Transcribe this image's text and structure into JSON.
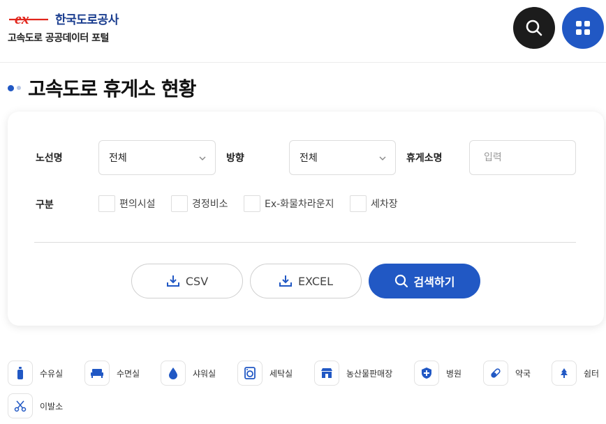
{
  "header": {
    "logo_brand": "한국도로공사",
    "logo_mark_text": "ex",
    "portal_name": "고속도로 공공데이터 포털"
  },
  "page": {
    "title": "고속도로 휴게소 현황"
  },
  "search": {
    "route_label": "노선명",
    "route_value": "전체",
    "direction_label": "방향",
    "direction_value": "전체",
    "rest_area_label": "휴게소명",
    "rest_area_placeholder": "입력",
    "category_label": "구분",
    "categories": [
      "편의시설",
      "경정비소",
      "Ex-화물차라운지",
      "세차장"
    ]
  },
  "buttons": {
    "csv": "CSV",
    "excel": "EXCEL",
    "search": "검색하기"
  },
  "amenities": [
    {
      "label": "수유실",
      "icon": "baby-bottle-icon"
    },
    {
      "label": "수면실",
      "icon": "bed-icon"
    },
    {
      "label": "샤워실",
      "icon": "water-drop-icon"
    },
    {
      "label": "세탁실",
      "icon": "washing-machine-icon"
    },
    {
      "label": "농산물판매장",
      "icon": "store-icon"
    },
    {
      "label": "병원",
      "icon": "medical-shield-icon"
    },
    {
      "label": "약국",
      "icon": "pill-icon"
    },
    {
      "label": "쉼터",
      "icon": "tree-icon"
    },
    {
      "label": "이발소",
      "icon": "scissors-icon"
    }
  ],
  "colors": {
    "primary": "#2158c4",
    "brand_red": "#e1251b",
    "brand_navy": "#1a3d8f",
    "dark": "#1c1c1c"
  }
}
